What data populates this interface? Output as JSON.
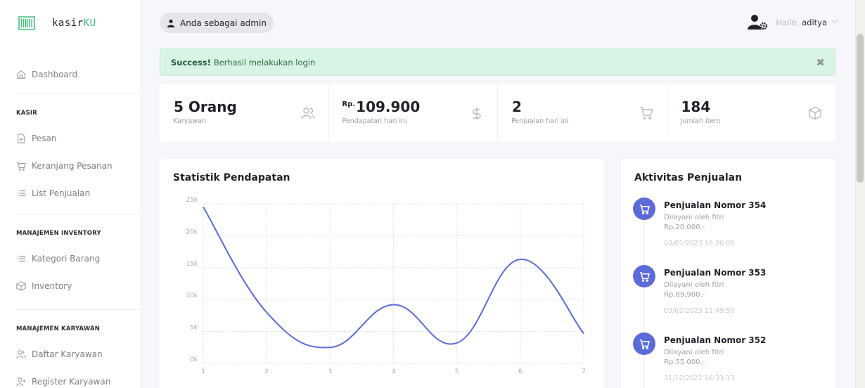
{
  "brand": {
    "name_a": "kasir",
    "name_b": "KU"
  },
  "sidebar": {
    "dashboard": "Dashboard",
    "sections": [
      {
        "title": "KASIR",
        "items": [
          "Pesan",
          "Keranjang Pesanan",
          "List Penjualan"
        ]
      },
      {
        "title": "MANAJEMEN INVENTORY",
        "items": [
          "Kategori Barang",
          "Inventory"
        ]
      },
      {
        "title": "MANAJEMEN KARYAWAN",
        "items": [
          "Daftar Karyawan",
          "Register Karyawan"
        ]
      }
    ]
  },
  "topbar": {
    "role_label": "Anda sebagai admin",
    "hello": "Hallo,",
    "username": "aditya"
  },
  "alert": {
    "strong": "Success!",
    "message": "Berhasil melakukan login",
    "close": "✖"
  },
  "stats": [
    {
      "prefix": "",
      "value": "5 Orang",
      "label": "Karyawan",
      "icon": "users-icon"
    },
    {
      "prefix": "Rp.",
      "value": "109.900",
      "label": "Pendapatan hari ini",
      "icon": "dollar-icon"
    },
    {
      "prefix": "",
      "value": "2",
      "label": "Penjualan hari ini",
      "icon": "cart-icon"
    },
    {
      "prefix": "",
      "value": "184",
      "label": "Jumlah item",
      "icon": "box-icon"
    }
  ],
  "chart_data": {
    "type": "line",
    "title": "Statistik Pendapatan",
    "x": [
      1,
      2,
      3,
      4,
      5,
      6,
      7
    ],
    "series": [
      {
        "values": [
          24500,
          8000,
          2500,
          9200,
          3200,
          16300,
          4700
        ]
      }
    ],
    "ylim": [
      0,
      25000
    ],
    "yticks": [
      "0k",
      "5k",
      "10k",
      "15k",
      "20k",
      "25k"
    ],
    "xticks": [
      "1",
      "2",
      "3",
      "4",
      "5",
      "6",
      "7"
    ],
    "grid": true,
    "color": "#5c6bd8"
  },
  "activity": {
    "title": "Aktivitas Penjualan",
    "items": [
      {
        "title": "Penjualan Nomor 354",
        "served": "Dilayani oleh fitri",
        "amount": "Rp.20.000,-",
        "time": "03/01/2023 16:20:00"
      },
      {
        "title": "Penjualan Nomor 353",
        "served": "Dilayani oleh fitri",
        "amount": "Rp.89.900,-",
        "time": "03/01/2023 11:49:50"
      },
      {
        "title": "Penjualan Nomor 352",
        "served": "Dilayani oleh fitri",
        "amount": "Rp.55.000,-",
        "time": "31/12/2022 16:33:13"
      }
    ]
  },
  "colors": {
    "accent": "#5c6bd8",
    "brand_green": "#3ec07a",
    "alert_bg": "#d9f3e4"
  }
}
